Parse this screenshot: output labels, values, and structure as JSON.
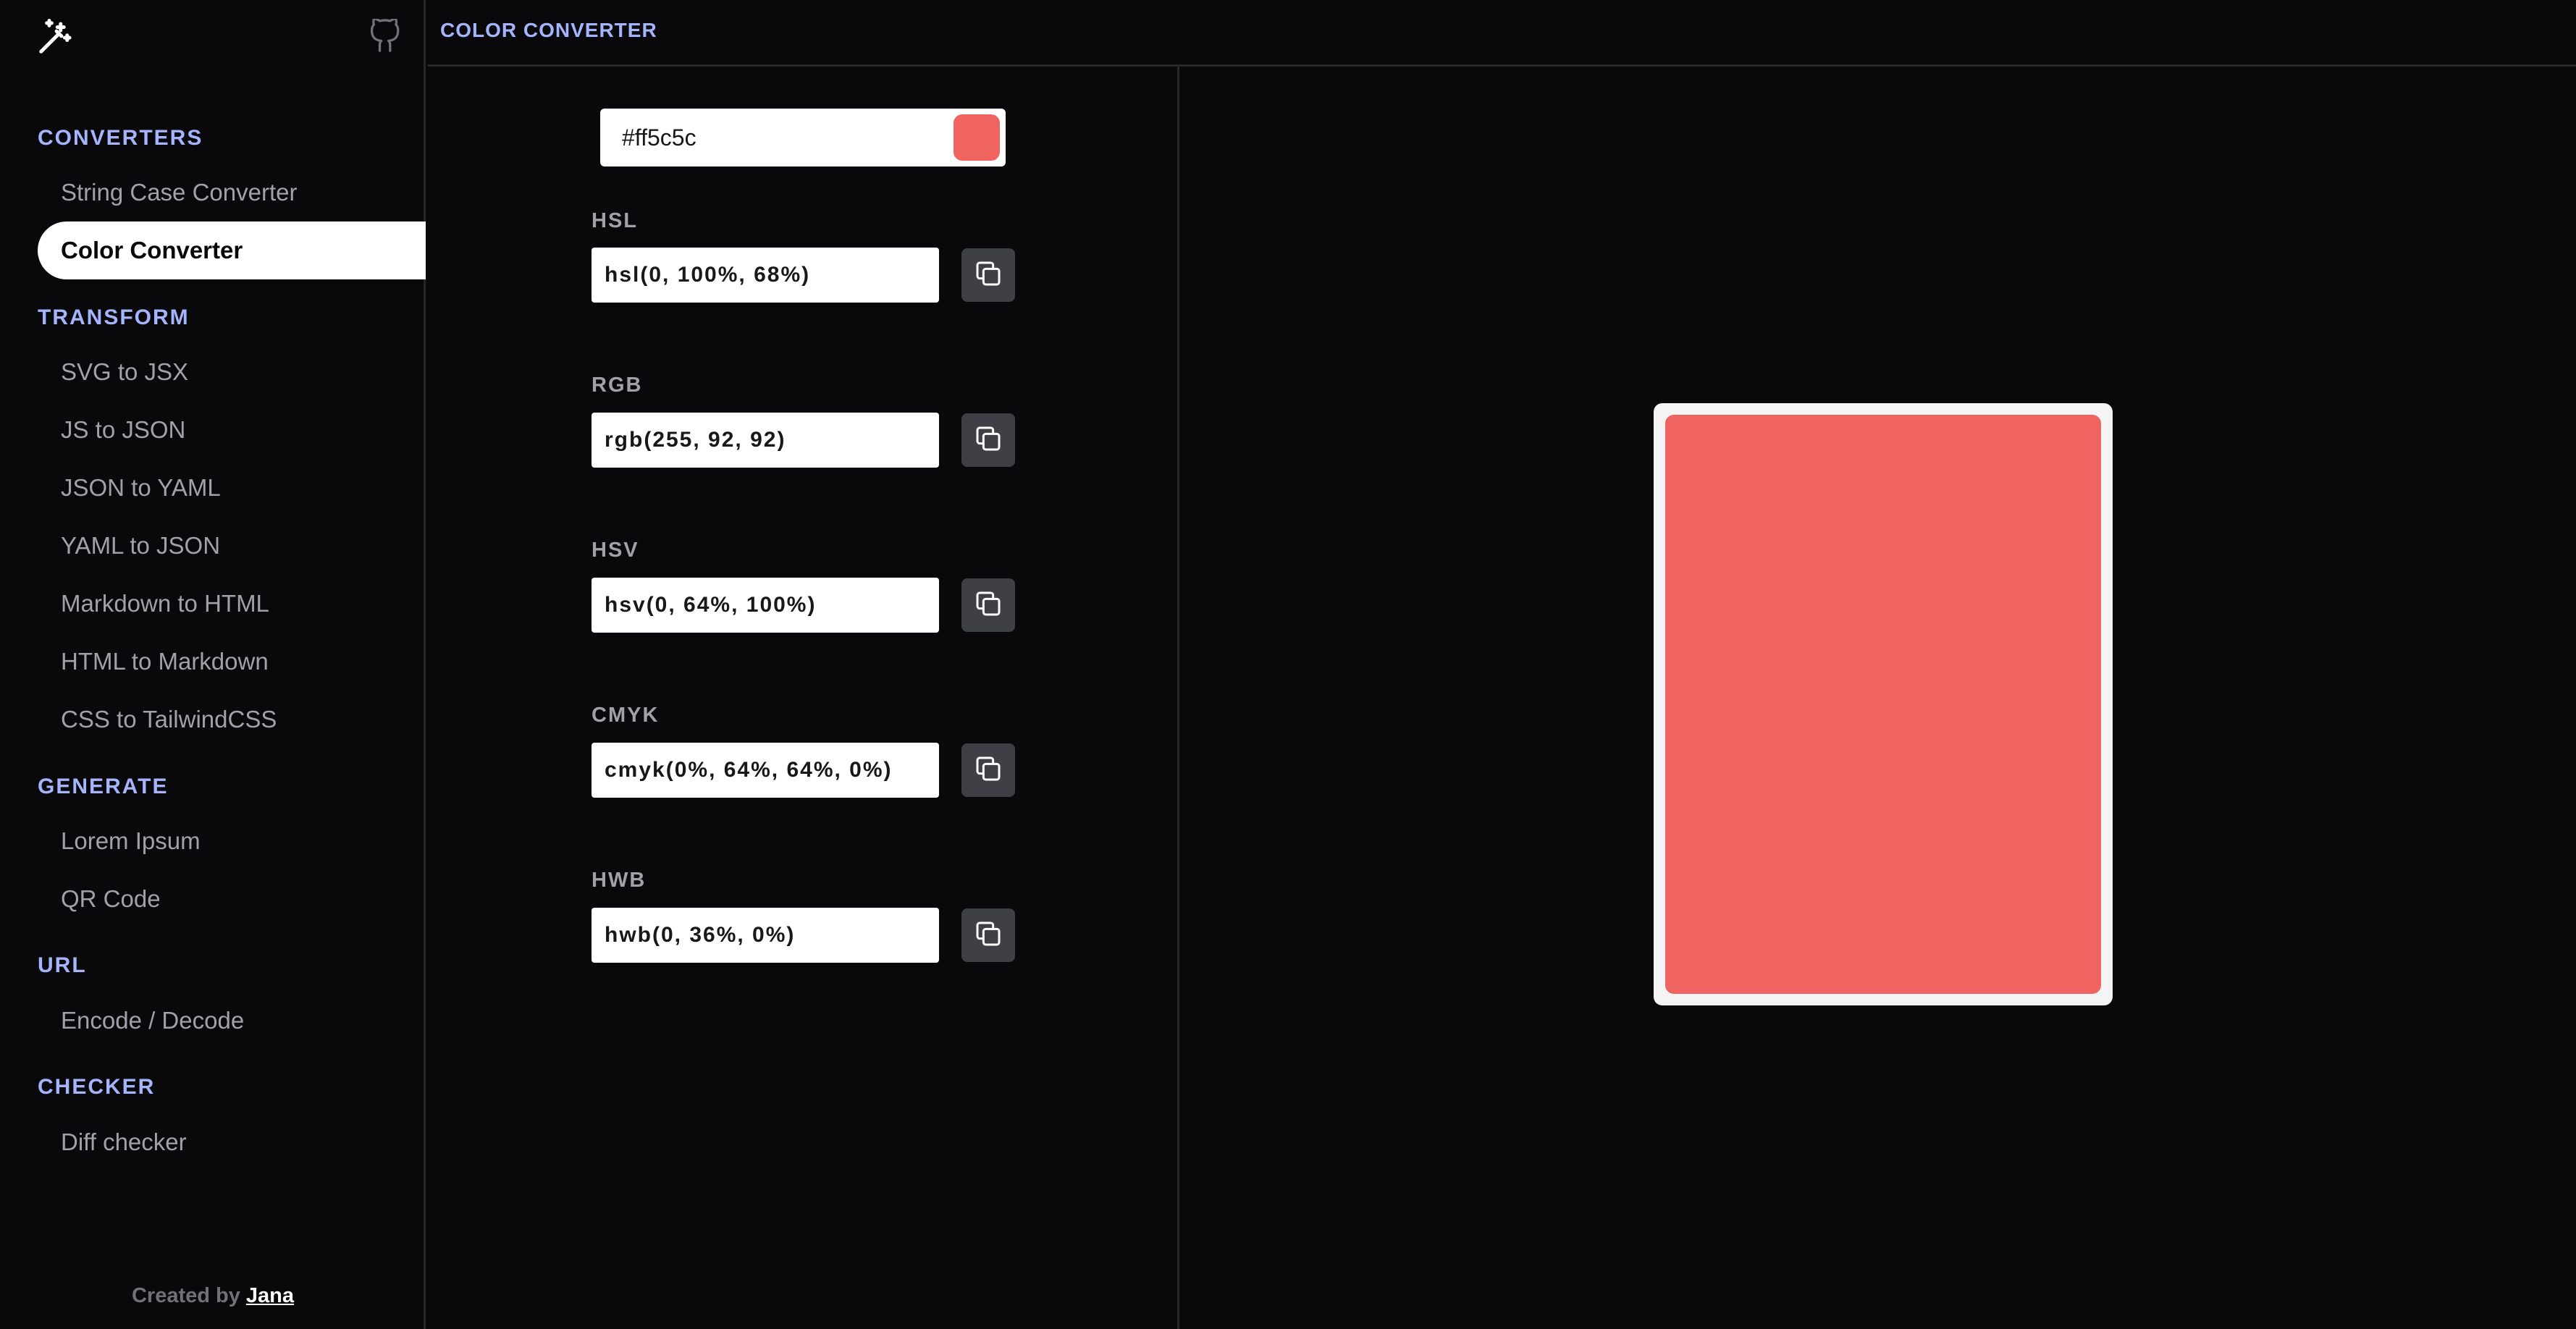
{
  "app": {
    "header_title": "COLOR CONVERTER",
    "logo_icon": "magic-wand-icon",
    "github_icon": "github-icon"
  },
  "sidebar": {
    "sections": [
      {
        "title": "CONVERTERS",
        "items": [
          "String Case Converter",
          "Color Converter"
        ]
      },
      {
        "title": "TRANSFORM",
        "items": [
          "SVG to JSX",
          "JS to JSON",
          "JSON to YAML",
          "YAML to JSON",
          "Markdown to HTML",
          "HTML to Markdown",
          "CSS to TailwindCSS"
        ]
      },
      {
        "title": "GENERATE",
        "items": [
          "Lorem Ipsum",
          "QR Code"
        ]
      },
      {
        "title": "URL",
        "items": [
          "Encode / Decode"
        ]
      },
      {
        "title": "CHECKER",
        "items": [
          "Diff checker"
        ]
      }
    ],
    "active_item": "Color Converter",
    "footer_prefix": "Created by",
    "footer_author": "Jana"
  },
  "converter": {
    "hex_value": "#ff5c5c",
    "swatch_color": "#ef6461",
    "fields": [
      {
        "label": "HSL",
        "value": "hsl(0, 100%, 68%)"
      },
      {
        "label": "RGB",
        "value": "rgb(255, 92, 92)"
      },
      {
        "label": "HSV",
        "value": "hsv(0, 64%, 100%)"
      },
      {
        "label": "CMYK",
        "value": "cmyk(0%, 64%, 64%, 0%)"
      },
      {
        "label": "HWB",
        "value": "hwb(0, 36%, 0%)"
      }
    ],
    "copy_icon": "copy-icon"
  },
  "preview": {
    "color": "#ef6461"
  },
  "colors": {
    "accent": "#a5b4fc",
    "background": "#09090b",
    "border": "#27272a"
  }
}
